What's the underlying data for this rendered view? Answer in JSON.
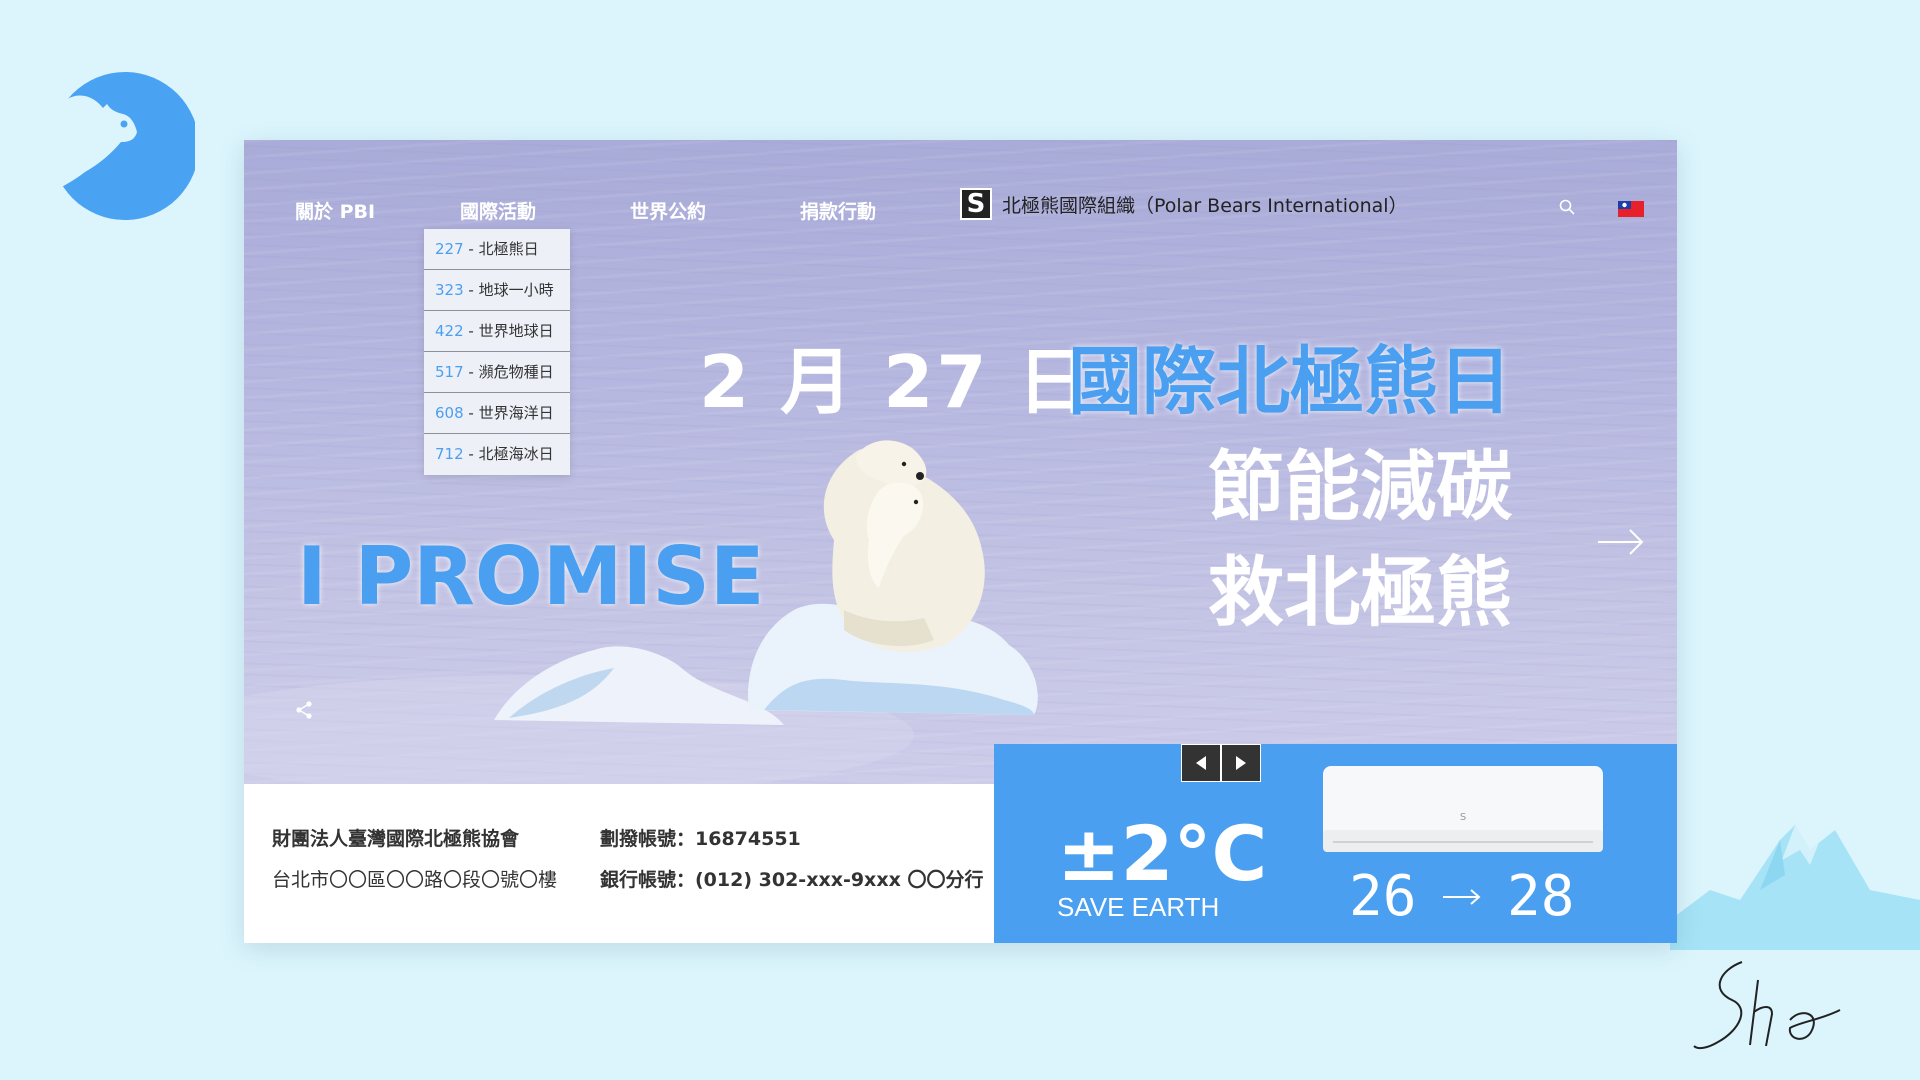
{
  "nav": {
    "about": "關於 PBI",
    "events": "國際活動",
    "treaty": "世界公約",
    "donate": "捐款行動"
  },
  "brand": {
    "logo_letter": "S",
    "name": "北極熊國際組織（Polar Bears International）"
  },
  "dropdown": [
    {
      "code": "227",
      "label": " - 北極熊日"
    },
    {
      "code": "323",
      "label": " - 地球一小時"
    },
    {
      "code": "422",
      "label": " - 世界地球日"
    },
    {
      "code": "517",
      "label": " - 瀕危物種日"
    },
    {
      "code": "608",
      "label": " - 世界海洋日"
    },
    {
      "code": "712",
      "label": " - 北極海冰日"
    }
  ],
  "hero": {
    "date": "2 月 27 日",
    "title": "國際北極熊日",
    "line2": "節能減碳",
    "line3": "救北極熊",
    "promise": "I PROMISE"
  },
  "info": {
    "org_name": "財團法人臺灣國際北極熊協會",
    "address": "台北市〇〇區〇〇路〇段〇號〇樓",
    "postal": "劃撥帳號：16874551",
    "bank": "銀行帳號：(012) 302-xxx-9xxx 〇〇分行"
  },
  "panel": {
    "temp": "±2°C",
    "slogan": "SAVE EARTH",
    "ac_brand": "S",
    "ac_from": "26",
    "ac_to": "28"
  },
  "colors": {
    "accent": "#4a9ff0",
    "background": "#dcf5fd",
    "dark": "#333333"
  },
  "icons": [
    "bear-logo-icon",
    "search-icon",
    "taiwan-flag-icon",
    "arrow-right-icon",
    "share-icon",
    "prev-arrow-icon",
    "next-arrow-icon",
    "mountain-icon",
    "signature"
  ]
}
